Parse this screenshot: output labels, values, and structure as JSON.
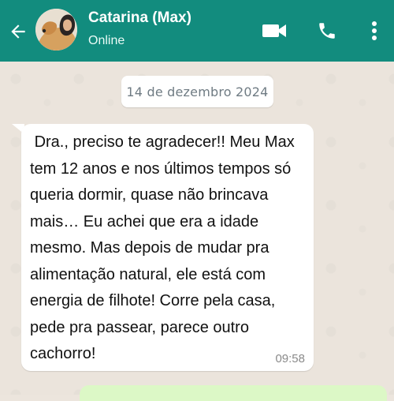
{
  "header": {
    "contact_name": "Catarina (Max)",
    "status": "Online",
    "background_color": "#128c7e",
    "icons": [
      "back-arrow-icon",
      "avatar",
      "video-call-icon",
      "phone-icon",
      "more-options-icon"
    ]
  },
  "chat": {
    "date": "14 de dezembro 2024",
    "messages": [
      {
        "text": " Dra., preciso te agradecer!! Meu Max\ntem 12 anos e nos últimos tempos só\nqueria dormir, quase não brincava\nmais… Eu achei que era a idade\nmesmo. Mas depois de mudar pra\nalimentação natural, ele está com\nenergia de filhote! Corre pela casa,\npede pra passear, parece outro\ncachorro!",
        "time": "09:58"
      }
    ]
  }
}
